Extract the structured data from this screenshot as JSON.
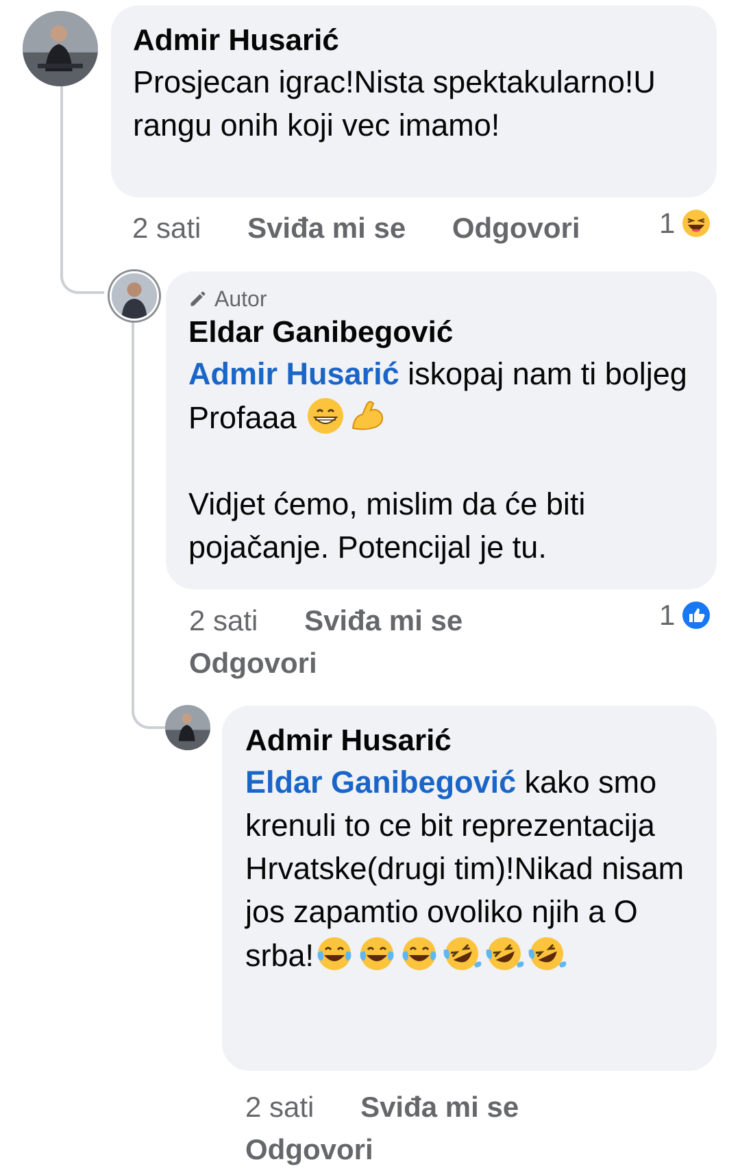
{
  "thread": {
    "comment_1": {
      "author": "Admir Husarić",
      "text": "Prosjecan igrac!Nista spektakularno!U rangu onih koji vec imamo!",
      "time": "2 sati",
      "like_label": "Sviđa mi se",
      "reply_label": "Odgovori",
      "reaction_count": "1",
      "reaction_icon": "haha-reaction-icon"
    },
    "comment_2": {
      "badge": "Autor",
      "author": "Eldar Ganibegović",
      "mention": "Admir Husarić",
      "text_1": " iskopaj nam ti boljeg Profaaa ",
      "text_2": "Vidjet ćemo, mislim da će biti pojačanje. Potencijal je tu.",
      "emojis": [
        "grinning-face-icon",
        "flexed-biceps-icon"
      ],
      "time": "2 sati",
      "like_label": "Sviđa mi se",
      "reply_label": "Odgovori",
      "reaction_count": "1",
      "reaction_icon": "like-reaction-icon"
    },
    "comment_3": {
      "author": "Admir Husarić",
      "mention": "Eldar Ganibegović",
      "text": " kako smo krenuli to ce bit reprezentacija Hrvatske(drugi tim)!Nikad nisam jos zapamtio ovoliko njih a O srba!",
      "emojis": [
        "tears-of-joy-icon",
        "tears-of-joy-icon",
        "tears-of-joy-icon",
        "rolling-laughing-icon",
        "rolling-laughing-icon",
        "rolling-laughing-icon"
      ],
      "time": "2 sati",
      "like_label": "Sviđa mi se",
      "reply_label": "Odgovori"
    }
  },
  "colors": {
    "bubble": "#f0f2f5",
    "mention": "#1a65c8",
    "meta": "#65676b",
    "like_blue": "#1877f2",
    "haha_yellow": "#f7b125"
  }
}
